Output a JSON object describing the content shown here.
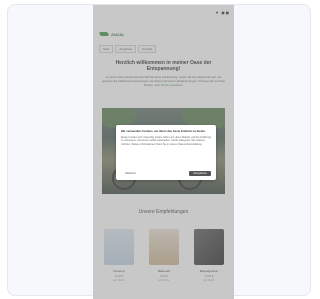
{
  "status_bar": {
    "icons": "♥ ◼◼"
  },
  "logo": {
    "text": "ANZAL"
  },
  "nav": {
    "items": [
      "Start",
      "Angebote",
      "Kontakt"
    ]
  },
  "headline": "Herzlich willkommen in meiner Oase der Entspannung!",
  "intro": {
    "text": "In meiner Oase erwartet Sie eine Welt der Ruhe und Erholung. Lassen Sie den Alltag hinter sich und genießen Sie wohltuende Anwendungen, die Körper und Geist in Einklang bringen. Ich freue mich auf Ihren Besuch.",
    "link": "Jetzt Termin vereinbaren"
  },
  "section": {
    "title": "Unsere Empfehlungen"
  },
  "products": [
    {
      "name": "Rosenöl",
      "price": "12,90 €",
      "meta": "inkl. MwSt."
    },
    {
      "name": "Badesalz",
      "price": "8,50 €",
      "meta": "inkl. MwSt."
    },
    {
      "name": "Massagestein",
      "price": "24,00 €",
      "meta": "inkl. MwSt."
    }
  ],
  "cookie_modal": {
    "title": "Wir verwenden Cookies, um Ihnen das beste Erlebnis zu bieten.",
    "body": "Einige Cookies sind notwendig, andere helfen uns, diese Website und Ihre Erfahrung zu verbessern. Sie können selbst entscheiden, welche Kategorien Sie zulassen möchten. Weitere Informationen finden Sie in unserer Datenschutzerklärung.",
    "decline_label": "Ablehnen",
    "accept_label": "Akzeptieren"
  }
}
